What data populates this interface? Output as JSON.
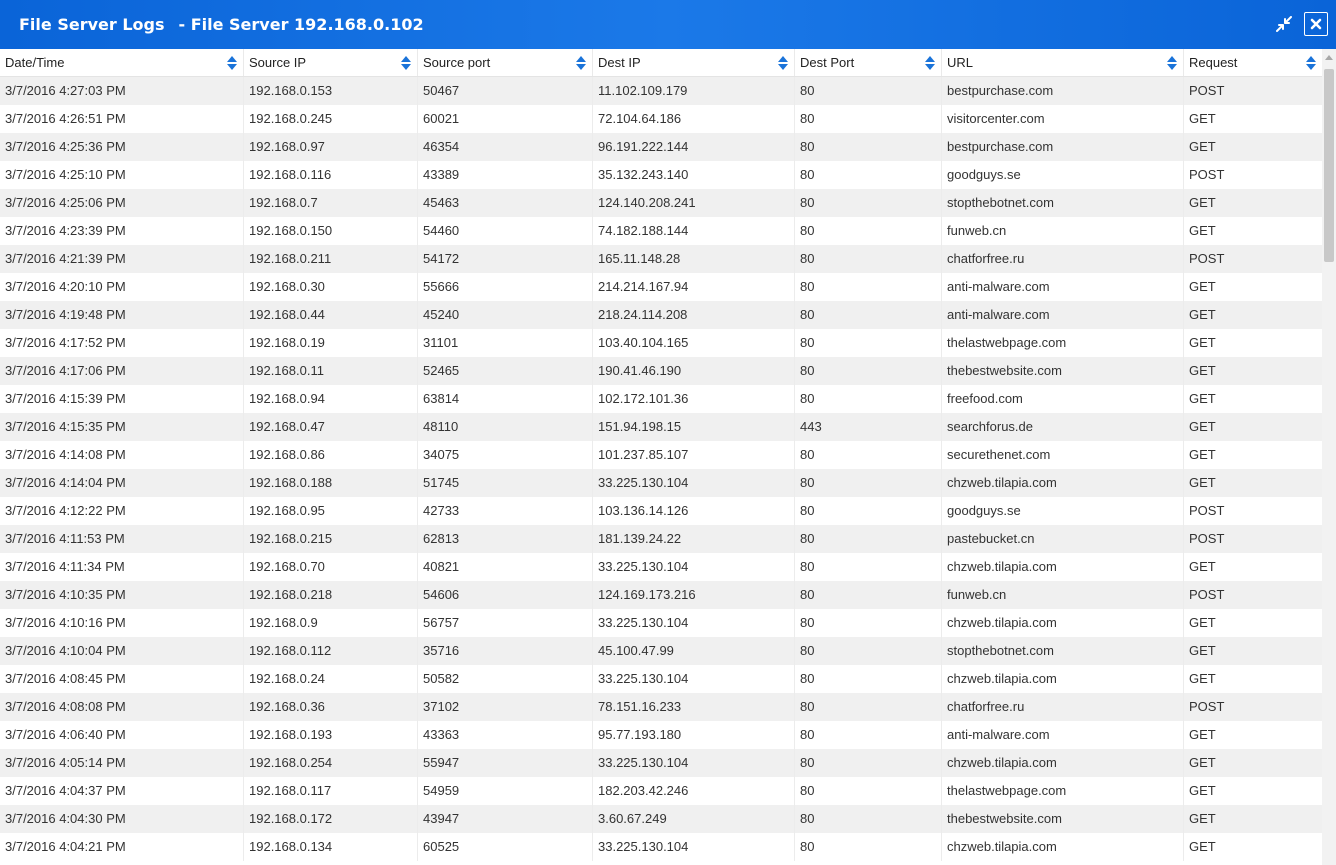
{
  "window": {
    "title": "File Server Logs",
    "subtitle": "- File Server 192.168.0.102"
  },
  "columns": [
    "Date/Time",
    "Source IP",
    "Source port",
    "Dest IP",
    "Dest Port",
    "URL",
    "Request"
  ],
  "rows": [
    [
      "3/7/2016 4:27:03 PM",
      "192.168.0.153",
      "50467",
      "11.102.109.179",
      "80",
      "bestpurchase.com",
      "POST"
    ],
    [
      "3/7/2016 4:26:51 PM",
      "192.168.0.245",
      "60021",
      "72.104.64.186",
      "80",
      "visitorcenter.com",
      "GET"
    ],
    [
      "3/7/2016 4:25:36 PM",
      "192.168.0.97",
      "46354",
      "96.191.222.144",
      "80",
      "bestpurchase.com",
      "GET"
    ],
    [
      "3/7/2016 4:25:10 PM",
      "192.168.0.116",
      "43389",
      "35.132.243.140",
      "80",
      "goodguys.se",
      "POST"
    ],
    [
      "3/7/2016 4:25:06 PM",
      "192.168.0.7",
      "45463",
      "124.140.208.241",
      "80",
      "stopthebotnet.com",
      "GET"
    ],
    [
      "3/7/2016 4:23:39 PM",
      "192.168.0.150",
      "54460",
      "74.182.188.144",
      "80",
      "funweb.cn",
      "GET"
    ],
    [
      "3/7/2016 4:21:39 PM",
      "192.168.0.211",
      "54172",
      "165.11.148.28",
      "80",
      "chatforfree.ru",
      "POST"
    ],
    [
      "3/7/2016 4:20:10 PM",
      "192.168.0.30",
      "55666",
      "214.214.167.94",
      "80",
      "anti-malware.com",
      "GET"
    ],
    [
      "3/7/2016 4:19:48 PM",
      "192.168.0.44",
      "45240",
      "218.24.114.208",
      "80",
      "anti-malware.com",
      "GET"
    ],
    [
      "3/7/2016 4:17:52 PM",
      "192.168.0.19",
      "31101",
      "103.40.104.165",
      "80",
      "thelastwebpage.com",
      "GET"
    ],
    [
      "3/7/2016 4:17:06 PM",
      "192.168.0.11",
      "52465",
      "190.41.46.190",
      "80",
      "thebestwebsite.com",
      "GET"
    ],
    [
      "3/7/2016 4:15:39 PM",
      "192.168.0.94",
      "63814",
      "102.172.101.36",
      "80",
      "freefood.com",
      "GET"
    ],
    [
      "3/7/2016 4:15:35 PM",
      "192.168.0.47",
      "48110",
      "151.94.198.15",
      "443",
      "searchforus.de",
      "GET"
    ],
    [
      "3/7/2016 4:14:08 PM",
      "192.168.0.86",
      "34075",
      "101.237.85.107",
      "80",
      "securethenet.com",
      "GET"
    ],
    [
      "3/7/2016 4:14:04 PM",
      "192.168.0.188",
      "51745",
      "33.225.130.104",
      "80",
      "chzweb.tilapia.com",
      "GET"
    ],
    [
      "3/7/2016 4:12:22 PM",
      "192.168.0.95",
      "42733",
      "103.136.14.126",
      "80",
      "goodguys.se",
      "POST"
    ],
    [
      "3/7/2016 4:11:53 PM",
      "192.168.0.215",
      "62813",
      "181.139.24.22",
      "80",
      "pastebucket.cn",
      "POST"
    ],
    [
      "3/7/2016 4:11:34 PM",
      "192.168.0.70",
      "40821",
      "33.225.130.104",
      "80",
      "chzweb.tilapia.com",
      "GET"
    ],
    [
      "3/7/2016 4:10:35 PM",
      "192.168.0.218",
      "54606",
      "124.169.173.216",
      "80",
      "funweb.cn",
      "POST"
    ],
    [
      "3/7/2016 4:10:16 PM",
      "192.168.0.9",
      "56757",
      "33.225.130.104",
      "80",
      "chzweb.tilapia.com",
      "GET"
    ],
    [
      "3/7/2016 4:10:04 PM",
      "192.168.0.112",
      "35716",
      "45.100.47.99",
      "80",
      "stopthebotnet.com",
      "GET"
    ],
    [
      "3/7/2016 4:08:45 PM",
      "192.168.0.24",
      "50582",
      "33.225.130.104",
      "80",
      "chzweb.tilapia.com",
      "GET"
    ],
    [
      "3/7/2016 4:08:08 PM",
      "192.168.0.36",
      "37102",
      "78.151.16.233",
      "80",
      "chatforfree.ru",
      "POST"
    ],
    [
      "3/7/2016 4:06:40 PM",
      "192.168.0.193",
      "43363",
      "95.77.193.180",
      "80",
      "anti-malware.com",
      "GET"
    ],
    [
      "3/7/2016 4:05:14 PM",
      "192.168.0.254",
      "55947",
      "33.225.130.104",
      "80",
      "chzweb.tilapia.com",
      "GET"
    ],
    [
      "3/7/2016 4:04:37 PM",
      "192.168.0.117",
      "54959",
      "182.203.42.246",
      "80",
      "thelastwebpage.com",
      "GET"
    ],
    [
      "3/7/2016 4:04:30 PM",
      "192.168.0.172",
      "43947",
      "3.60.67.249",
      "80",
      "thebestwebsite.com",
      "GET"
    ],
    [
      "3/7/2016 4:04:21 PM",
      "192.168.0.134",
      "60525",
      "33.225.130.104",
      "80",
      "chzweb.tilapia.com",
      "GET"
    ]
  ],
  "icons": {
    "minimize": "collapse-arrows-icon",
    "close": "close-icon",
    "sort": "sort-icon"
  },
  "colors": {
    "titlebar": "#0a64d8",
    "sort_icon": "#1a73d9",
    "row_alt": "#f0f0f0"
  }
}
